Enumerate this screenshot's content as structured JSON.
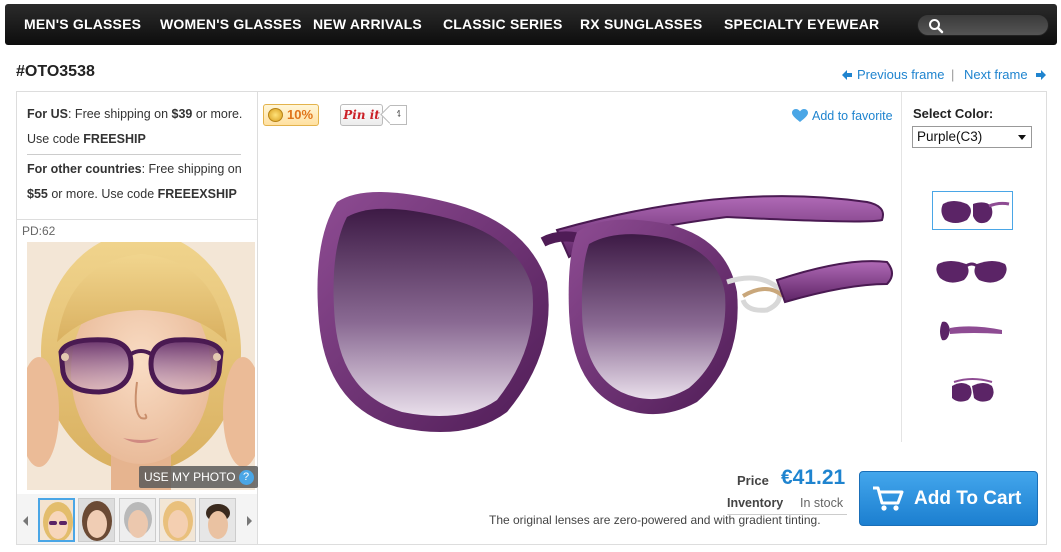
{
  "nav": {
    "items": [
      "MEN'S GLASSES",
      "WOMEN'S GLASSES",
      "NEW ARRIVALS",
      "CLASSIC SERIES",
      "RX SUNGLASSES",
      "SPECIALTY EYEWEAR"
    ],
    "search_icon": "search-icon"
  },
  "product": {
    "sku": "#OTO3538",
    "prev_label": "Previous frame",
    "next_label": "Next frame",
    "separator": "|"
  },
  "shipping": {
    "us_label": "For US",
    "us_text_1": ": Free shipping on ",
    "us_amount": "$39",
    "us_text_2": " or more.",
    "us_code_text": "Use code ",
    "us_code": "FREESHIP",
    "intl_label": "For other countries",
    "intl_text_1": ": Free shipping on",
    "intl_amount": "$55",
    "intl_text_2": " or more. Use code ",
    "intl_code": "FREEEXSHIP"
  },
  "tryon": {
    "pd_label": "PD:62",
    "use_photo_label": "USE MY PHOTO",
    "help_glyph": "?"
  },
  "promo": {
    "discount": "10%",
    "pinit_label": "Pin it",
    "pin_count": "4",
    "favorite_label": "Add to favorite"
  },
  "color": {
    "label": "Select Color:",
    "selected": "Purple(C3)"
  },
  "purchase": {
    "price_label": "Price",
    "price": "€41.21",
    "inventory_label": "Inventory",
    "inventory_value": "In stock",
    "lens_note": "The original lenses are zero-powered and with gradient tinting.",
    "add_to_cart": "Add To Cart"
  },
  "colors": {
    "accent": "#1f84cf",
    "frame_purple": "#6a2a6e",
    "nav_bg": "#1a1a1a"
  }
}
